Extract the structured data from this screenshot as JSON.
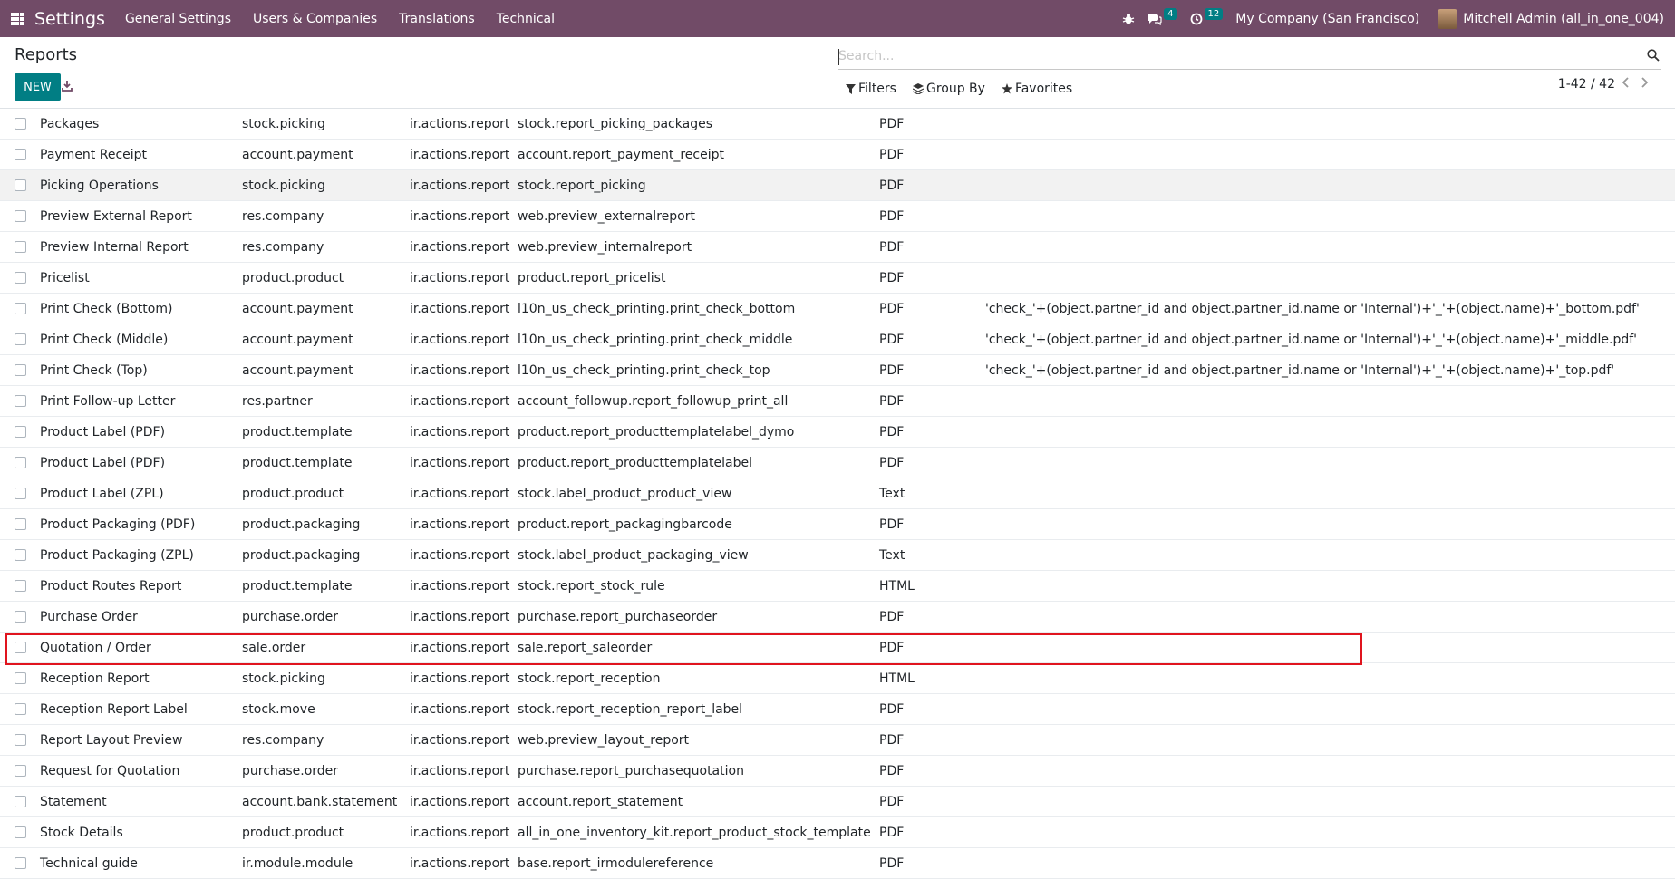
{
  "nav": {
    "brand": "Settings",
    "menu": [
      "General Settings",
      "Users & Companies",
      "Translations",
      "Technical"
    ],
    "messages_count": "4",
    "activities_count": "12",
    "company": "My Company (San Francisco)",
    "user": "Mitchell Admin (all_in_one_004)",
    "accent_color": "#714b67"
  },
  "control": {
    "title": "Reports",
    "new_label": "NEW",
    "search_placeholder": "Search...",
    "filters_label": "Filters",
    "groupby_label": "Group By",
    "favorites_label": "Favorites",
    "pager": "1-42 / 42",
    "button_color": "#017e84"
  },
  "rows": [
    [
      "Packages",
      "stock.picking",
      "ir.actions.report",
      "stock.report_picking_packages",
      "PDF",
      ""
    ],
    [
      "Payment Receipt",
      "account.payment",
      "ir.actions.report",
      "account.report_payment_receipt",
      "PDF",
      ""
    ],
    [
      "Picking Operations",
      "stock.picking",
      "ir.actions.report",
      "stock.report_picking",
      "PDF",
      ""
    ],
    [
      "Preview External Report",
      "res.company",
      "ir.actions.report",
      "web.preview_externalreport",
      "PDF",
      ""
    ],
    [
      "Preview Internal Report",
      "res.company",
      "ir.actions.report",
      "web.preview_internalreport",
      "PDF",
      ""
    ],
    [
      "Pricelist",
      "product.product",
      "ir.actions.report",
      "product.report_pricelist",
      "PDF",
      ""
    ],
    [
      "Print Check (Bottom)",
      "account.payment",
      "ir.actions.report",
      "l10n_us_check_printing.print_check_bottom",
      "PDF",
      "'check_'+(object.partner_id and object.partner_id.name or 'Internal')+'_'+(object.name)+'_bottom.pdf'"
    ],
    [
      "Print Check (Middle)",
      "account.payment",
      "ir.actions.report",
      "l10n_us_check_printing.print_check_middle",
      "PDF",
      "'check_'+(object.partner_id and object.partner_id.name or 'Internal')+'_'+(object.name)+'_middle.pdf'"
    ],
    [
      "Print Check (Top)",
      "account.payment",
      "ir.actions.report",
      "l10n_us_check_printing.print_check_top",
      "PDF",
      "'check_'+(object.partner_id and object.partner_id.name or 'Internal')+'_'+(object.name)+'_top.pdf'"
    ],
    [
      "Print Follow-up Letter",
      "res.partner",
      "ir.actions.report",
      "account_followup.report_followup_print_all",
      "PDF",
      ""
    ],
    [
      "Product Label (PDF)",
      "product.template",
      "ir.actions.report",
      "product.report_producttemplatelabel_dymo",
      "PDF",
      ""
    ],
    [
      "Product Label (PDF)",
      "product.template",
      "ir.actions.report",
      "product.report_producttemplatelabel",
      "PDF",
      ""
    ],
    [
      "Product Label (ZPL)",
      "product.product",
      "ir.actions.report",
      "stock.label_product_product_view",
      "Text",
      ""
    ],
    [
      "Product Packaging (PDF)",
      "product.packaging",
      "ir.actions.report",
      "product.report_packagingbarcode",
      "PDF",
      ""
    ],
    [
      "Product Packaging (ZPL)",
      "product.packaging",
      "ir.actions.report",
      "stock.label_product_packaging_view",
      "Text",
      ""
    ],
    [
      "Product Routes Report",
      "product.template",
      "ir.actions.report",
      "stock.report_stock_rule",
      "HTML",
      ""
    ],
    [
      "Purchase Order",
      "purchase.order",
      "ir.actions.report",
      "purchase.report_purchaseorder",
      "PDF",
      ""
    ],
    [
      "Quotation / Order",
      "sale.order",
      "ir.actions.report",
      "sale.report_saleorder",
      "PDF",
      ""
    ],
    [
      "Reception Report",
      "stock.picking",
      "ir.actions.report",
      "stock.report_reception",
      "HTML",
      ""
    ],
    [
      "Reception Report Label",
      "stock.move",
      "ir.actions.report",
      "stock.report_reception_report_label",
      "PDF",
      ""
    ],
    [
      "Report Layout Preview",
      "res.company",
      "ir.actions.report",
      "web.preview_layout_report",
      "PDF",
      ""
    ],
    [
      "Request for Quotation",
      "purchase.order",
      "ir.actions.report",
      "purchase.report_purchasequotation",
      "PDF",
      ""
    ],
    [
      "Statement",
      "account.bank.statement",
      "ir.actions.report",
      "account.report_statement",
      "PDF",
      ""
    ],
    [
      "Stock Details",
      "product.product",
      "ir.actions.report",
      "all_in_one_inventory_kit.report_product_stock_template",
      "PDF",
      ""
    ],
    [
      "Technical guide",
      "ir.module.module",
      "ir.actions.report",
      "base.report_irmodulereference",
      "PDF",
      ""
    ]
  ]
}
